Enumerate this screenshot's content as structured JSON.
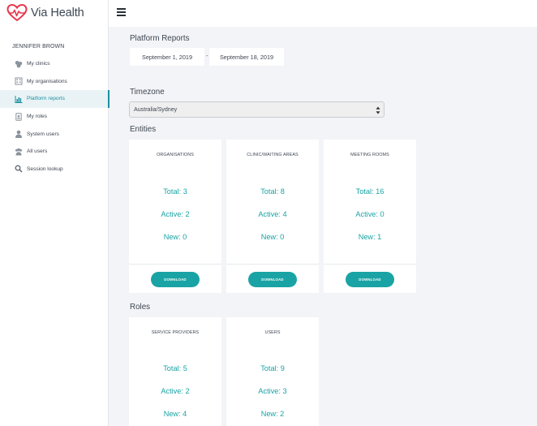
{
  "app": {
    "name": "Via Health",
    "brand_color": "#e8374e",
    "accent_color": "#1aa3a4"
  },
  "sidebar": {
    "user_name": "JENNIFER BROWN",
    "items": [
      {
        "label": "My clinics",
        "icon": "clinics-icon",
        "active": false
      },
      {
        "label": "My organisations",
        "icon": "organisation-icon",
        "active": false
      },
      {
        "label": "Platform reports",
        "icon": "bar-chart-icon",
        "active": true
      },
      {
        "label": "My roles",
        "icon": "id-badge-icon",
        "active": false
      },
      {
        "label": "System users",
        "icon": "user-icon",
        "active": false
      },
      {
        "label": "All users",
        "icon": "users-icon",
        "active": false
      },
      {
        "label": "Session lookup",
        "icon": "search-icon",
        "active": false
      }
    ]
  },
  "header": {
    "menu_icon": "hamburger-icon"
  },
  "reports": {
    "title": "Platform Reports",
    "date_from": "September 1, 2019",
    "date_separator": "-",
    "date_to": "September 18, 2019"
  },
  "timezone": {
    "label": "Timezone",
    "value": "Australia/Sydney"
  },
  "entities": {
    "title": "Entities",
    "cards": [
      {
        "title": "ORGANISATIONS",
        "total": "Total: 3",
        "active": "Active: 2",
        "new": "New: 0",
        "button": "DOWNLOAD"
      },
      {
        "title": "CLINIC/WAITING AREAS",
        "total": "Total: 8",
        "active": "Active: 4",
        "new": "New: 0",
        "button": "DOWNLOAD"
      },
      {
        "title": "MEETING ROOMS",
        "total": "Total: 16",
        "active": "Active: 0",
        "new": "New: 1",
        "button": "DOWNLOAD"
      }
    ]
  },
  "roles": {
    "title": "Roles",
    "cards": [
      {
        "title": "SERVICE PROVIDERS",
        "total": "Total: 5",
        "active": "Active: 2",
        "new": "New: 4"
      },
      {
        "title": "USERS",
        "total": "Total: 9",
        "active": "Active: 3",
        "new": "New: 2"
      }
    ]
  }
}
